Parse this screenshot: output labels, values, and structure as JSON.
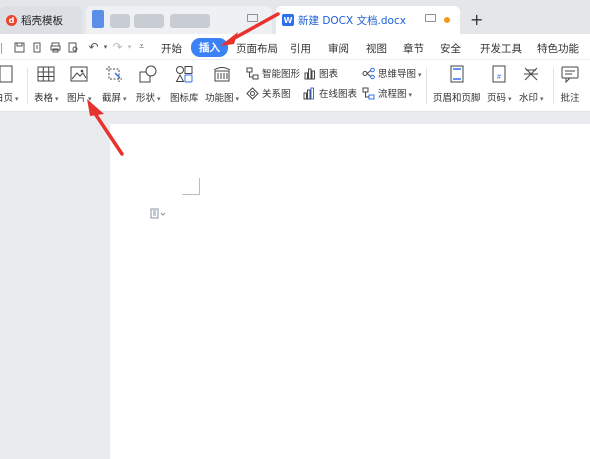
{
  "tabs": [
    {
      "title": "稻壳模板",
      "icon": "docer-logo-icon"
    },
    {
      "title": "",
      "icon": "blurred-doc-icon"
    },
    {
      "title": "新建 DOCX 文档.docx",
      "icon": "word-doc-icon"
    }
  ],
  "new_tab_label": "+",
  "menu": {
    "items": [
      "开始",
      "插入",
      "页面布局",
      "引用",
      "审阅",
      "视图",
      "章节",
      "安全",
      "开发工具",
      "特色功能"
    ],
    "active": "插入"
  },
  "ribbon": {
    "partial_left_label": "白页",
    "buttons": [
      {
        "label": "表格",
        "icon": "table-icon",
        "caret": true
      },
      {
        "label": "图片",
        "icon": "picture-icon",
        "caret": true
      },
      {
        "label": "截屏",
        "icon": "screenshot-icon",
        "caret": true
      },
      {
        "label": "形状",
        "icon": "shapes-icon",
        "caret": true
      },
      {
        "label": "图标库",
        "icon": "icon-library-icon",
        "caret": false
      },
      {
        "label": "功能图",
        "icon": "function-chart-icon",
        "caret": true
      }
    ],
    "small_buttons": [
      {
        "label": "智能图形",
        "icon": "smart-graphic-icon",
        "caret": false
      },
      {
        "label": "关系图",
        "icon": "relation-chart-icon",
        "caret": false
      },
      {
        "label": "图表",
        "icon": "chart-icon",
        "caret": false
      },
      {
        "label": "在线图表",
        "icon": "online-chart-icon",
        "caret": false
      },
      {
        "label": "思维导图",
        "icon": "mind-map-icon",
        "caret": true
      },
      {
        "label": "流程图",
        "icon": "flowchart-icon",
        "caret": true
      }
    ],
    "right_buttons": [
      {
        "label": "页眉和页脚",
        "icon": "header-footer-icon",
        "caret": false
      },
      {
        "label": "页码",
        "icon": "page-number-icon",
        "caret": true
      },
      {
        "label": "水印",
        "icon": "watermark-icon",
        "caret": true
      },
      {
        "label": "批注",
        "icon": "comment-icon",
        "caret": false
      }
    ]
  },
  "colors": {
    "accent": "#3b82f6",
    "annotation_arrow": "#e8322d",
    "doc_tab_text": "#1d5fd6",
    "modified_dot": "#f39a1e"
  }
}
